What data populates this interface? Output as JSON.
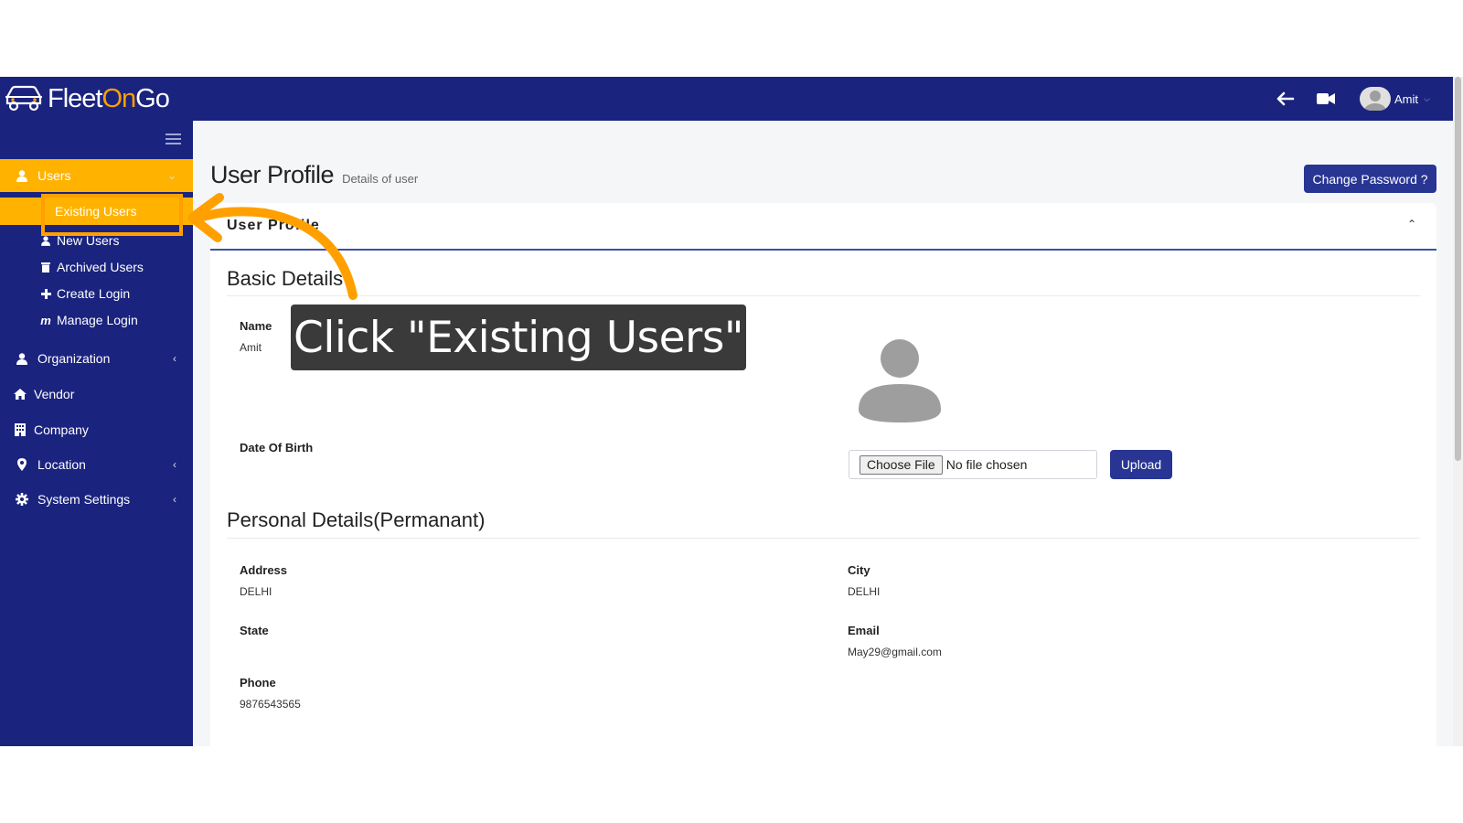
{
  "app": {
    "brand_fleet": "Fleet",
    "brand_on": "On",
    "brand_go": "Go",
    "colors": {
      "navy": "#1a237e",
      "accent": "#ffb300",
      "button": "#283593"
    }
  },
  "topbar": {
    "back_icon": "arrow-left-icon",
    "video_icon": "video-camera-icon",
    "user_name": "Amit"
  },
  "sidebar": {
    "users": {
      "label": "Users",
      "icon": "user-icon"
    },
    "users_sub": [
      {
        "label": "Existing Users",
        "icon": "user-icon"
      },
      {
        "label": "New Users",
        "icon": "user-icon"
      },
      {
        "label": "Archived Users",
        "icon": "trash-icon"
      },
      {
        "label": "Create Login",
        "icon": "plus-icon"
      },
      {
        "label": "Manage Login",
        "icon": "m-icon"
      }
    ],
    "organization": {
      "label": "Organization",
      "icon": "user-icon"
    },
    "vendor": {
      "label": "Vendor",
      "icon": "home-icon"
    },
    "company": {
      "label": "Company",
      "icon": "building-icon"
    },
    "location": {
      "label": "Location",
      "icon": "map-marker-icon"
    },
    "system_settings": {
      "label": "System Settings",
      "icon": "gear-icon"
    }
  },
  "page": {
    "title": "User Profile",
    "subtitle": "Details of user",
    "change_password": "Change Password ?"
  },
  "card": {
    "title": "User Profile",
    "basic_details": {
      "heading": "Basic Details",
      "name_label": "Name",
      "name_value": "Amit",
      "dob_label": "Date Of Birth",
      "choose_file": "Choose File",
      "no_file": "No file chosen",
      "upload": "Upload"
    },
    "personal_details": {
      "heading": "Personal Details(Permanant)",
      "address_label": "Address",
      "address_value": "DELHI",
      "city_label": "City",
      "city_value": "DELHI",
      "state_label": "State",
      "email_label": "Email",
      "email_value": "May29@gmail.com",
      "phone_label": "Phone",
      "phone_value": "9876543565"
    }
  },
  "tutorial": {
    "callout": "Click \"Existing Users\""
  }
}
